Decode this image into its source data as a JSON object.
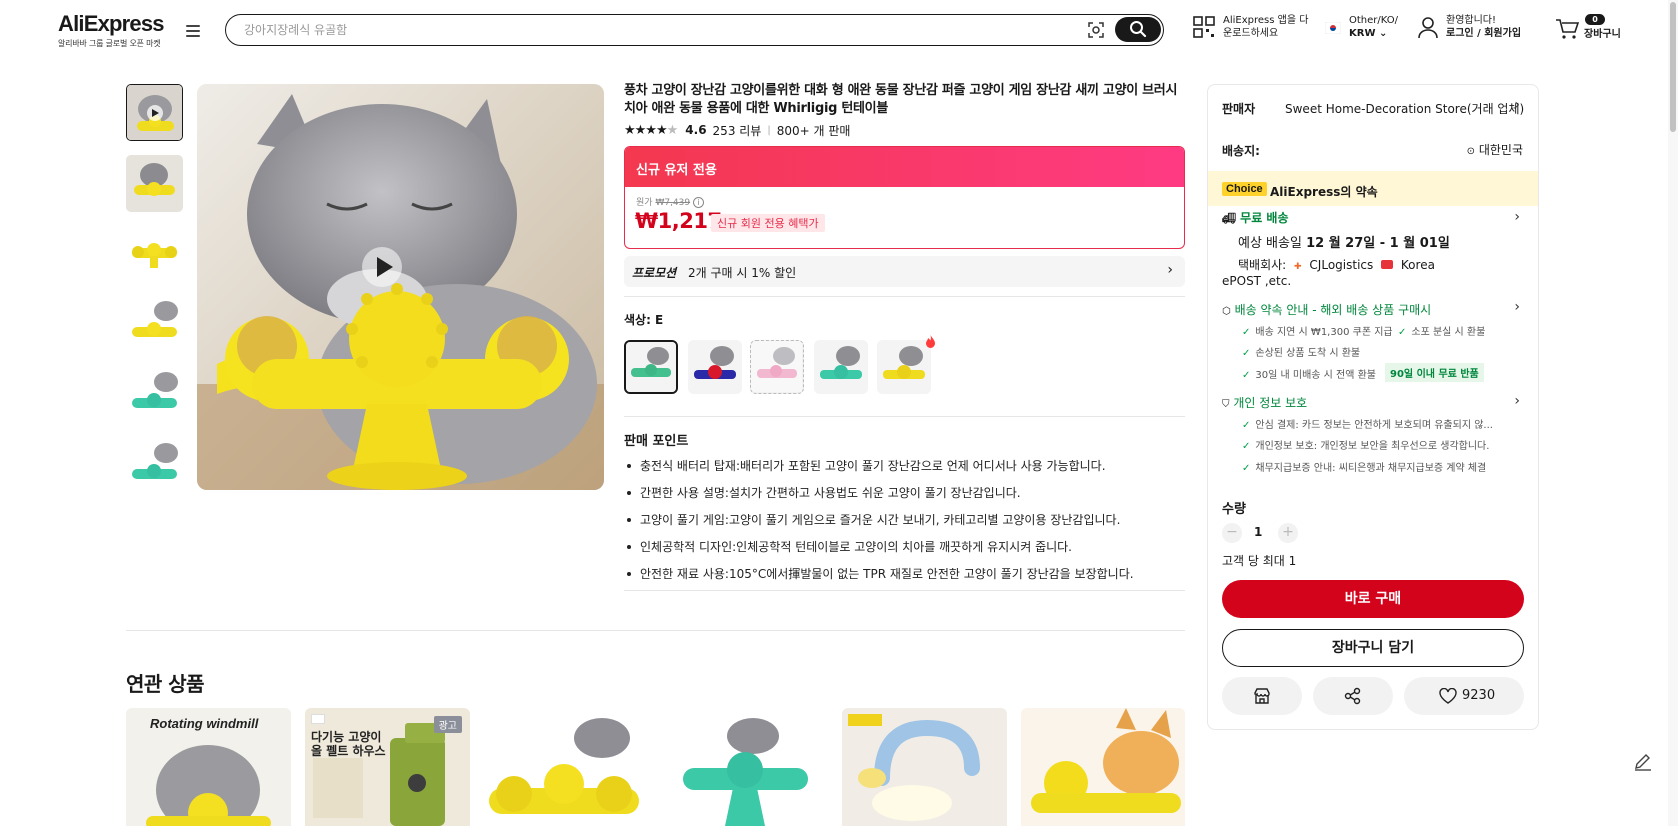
{
  "header": {
    "logo_text": "AliExpress",
    "logo_sub": "알리바바 그룹 글로벌 오픈 마켓",
    "search_placeholder": "강아지장례식 유골함",
    "app_line1": "AliExpress 앱을 다",
    "app_line2": "운로드하세요",
    "region_line1": "Other/KO/",
    "region_line2": "KRW",
    "account_line1": "환영합니다!",
    "account_line2": "로그인 / 회원가입",
    "cart_count": "0",
    "cart_label": "장바구니"
  },
  "product": {
    "title": "풍차 고양이 장난감 고양이를위한 대화 형 애완 동물 장난감 퍼즐 고양이 게임 장난감 새끼 고양이 브러시 치아 애완 동물 용품에 대한 Whirligig 턴테이블",
    "rating": "4.6",
    "reviews": "253 리뷰",
    "sold": "800+ 개 판매",
    "deal_header": "신규 유저 전용",
    "original_label": "원가",
    "original_price": "₩7,439",
    "price": "₩1,217",
    "price_tag": "신규 회원 전용 혜택가",
    "promo_label": "프로모션",
    "promo_text": "2개 구매 시 1% 할인",
    "color_label": "색상: E",
    "points_title": "판매 포인트",
    "points": [
      "충전식 배터리 탑재:배터리가 포함된 고양이 풀기 장난감으로 언제 어디서나 사용 가능합니다.",
      "간편한 사용 설명:설치가 간편하고 사용법도 쉬운 고양이 풀기 장난감입니다.",
      "고양이 풀기 게임:고양이 풀기 게임으로 즐거운 시간 보내기, 카테고리별 고양이용 장난감입니다.",
      "인체공학적 디자인:인체공학적 턴테이블로 고양이의 치아를 깨끗하게 유지시켜 줍니다.",
      "안전한 재료 사용:105°C에서揮발물이 없는 TPR 재질로 안전한 고양이 풀기 장난감을 보장합니다."
    ]
  },
  "related": {
    "title": "연관 상품",
    "ad_badge": "광고",
    "card1_text": "Rotating windmill",
    "card2_text": "다기능 고양이 올 펠트 하우스"
  },
  "sidebar": {
    "seller_label": "판매자",
    "seller_name": "Sweet Home-Decoration Store(거래 업체)",
    "ship_to_label": "배송지:",
    "ship_to": "대한민국",
    "choice_tag": "Choice",
    "choice_text": "AliExpress의 약속",
    "free_ship": "무료 배송",
    "eta_prefix": "예상 배송일",
    "eta": "12 월 27일 - 1 월 01일",
    "carrier_label": "택배회사:",
    "carrier1": "CJLogistics",
    "carrier2": "Korea",
    "carrier3": "ePOST ,etc.",
    "promise_title": "배송 약속 안내 - 해외 배송 상품 구매시",
    "promise1": "배송 지연 시 ₩1,300 쿠폰 지급",
    "promise2": "소포 분실 시 환불",
    "promise3": "손상된 상품 도착 시 환불",
    "promise4": "30일 내 미배송 시 전액 환불",
    "promise_badge": "90일 이내 무료 반품",
    "privacy_title": "개인 정보 보호",
    "privacy1": "안심 결제: 카드 정보는 안전하게 보호되며 유출되지 않...",
    "privacy2": "개인정보 보호: 개인정보 보안을 최우선으로 생각합니다.",
    "privacy3": "채무지급보증 안내: 씨티은행과 채무지급보증 계약 체결",
    "qty_label": "수량",
    "qty_value": "1",
    "qty_limit": "고객 당 최대 1",
    "buy_now": "바로 구매",
    "add_to_cart": "장바구니 담기",
    "wishlist_count": "9230"
  }
}
